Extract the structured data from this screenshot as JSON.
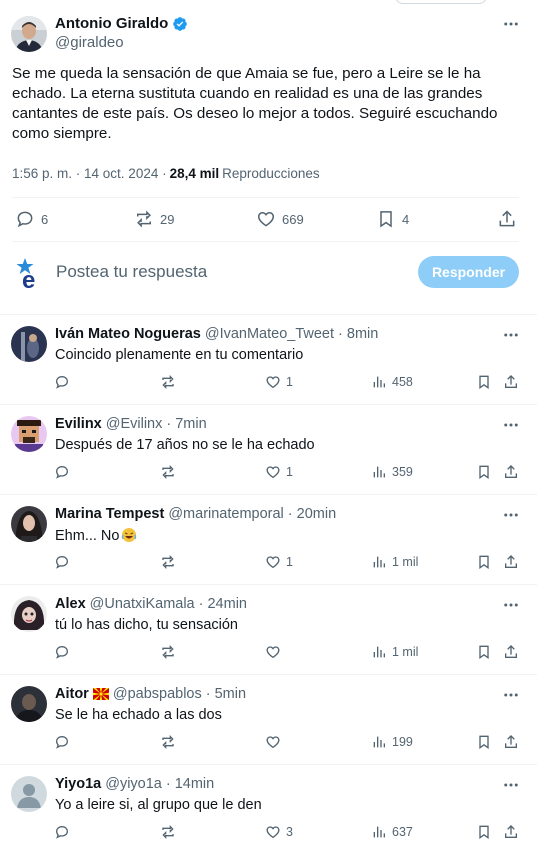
{
  "tweet": {
    "author_name": "Antonio Giraldo",
    "author_handle": "@giraldeo",
    "text": "Se me queda la sensación de que Amaia se fue, pero a Leire se le ha\nechado. La eterna sustituta cuando en realidad es una de las grandes\ncantantes de este país. Os deseo lo mejor a todos. Seguiré escuchando\ncomo siempre.",
    "time": "1:56 p. m. · 14 oct. 2024 ·",
    "views_count": "28,4 mil",
    "views_label": "Reproducciones",
    "stats": {
      "replies": "6",
      "retweets": "29",
      "likes": "669",
      "bookmarks": "4"
    }
  },
  "reply_box": {
    "placeholder": "Postea tu respuesta",
    "button": "Responder"
  },
  "replies": [
    {
      "name": "Iván Mateo Nogueras",
      "handle": "@IvanMateo_Tweet",
      "time": "· 8min",
      "text": "Coincido plenamente en tu comentario",
      "likes": "1",
      "views": "458"
    },
    {
      "name": "Evilinx",
      "handle": "@Evilinx",
      "time": "· 7min",
      "text": "Después de 17 años no se le ha echado",
      "likes": "1",
      "views": "359"
    },
    {
      "name": "Marina Tempest",
      "handle": "@marinatemporal",
      "time": "· 20min",
      "text": "Ehm... No",
      "likes": "1",
      "views": "1 mil"
    },
    {
      "name": "Alex",
      "handle": "@UnatxiKamala",
      "time": "· 24min",
      "text": "tú lo has dicho, tu sensación",
      "likes": "",
      "views": "1 mil"
    },
    {
      "name": "Aitor",
      "handle": "@pabspablos",
      "time": "· 5min",
      "text": "Se le ha echado a las dos",
      "likes": "",
      "views": "199"
    },
    {
      "name": "Yiyo1a",
      "handle": "@yiyo1a",
      "time": "· 14min",
      "text": "Yo a leire si, al grupo que le den",
      "likes": "3",
      "views": "637"
    }
  ],
  "colors": {
    "accent": "#1d9bf0",
    "button_disabled": "#8ecdf8",
    "muted": "#536471",
    "text": "#0f1419",
    "border": "#eff3f4"
  }
}
